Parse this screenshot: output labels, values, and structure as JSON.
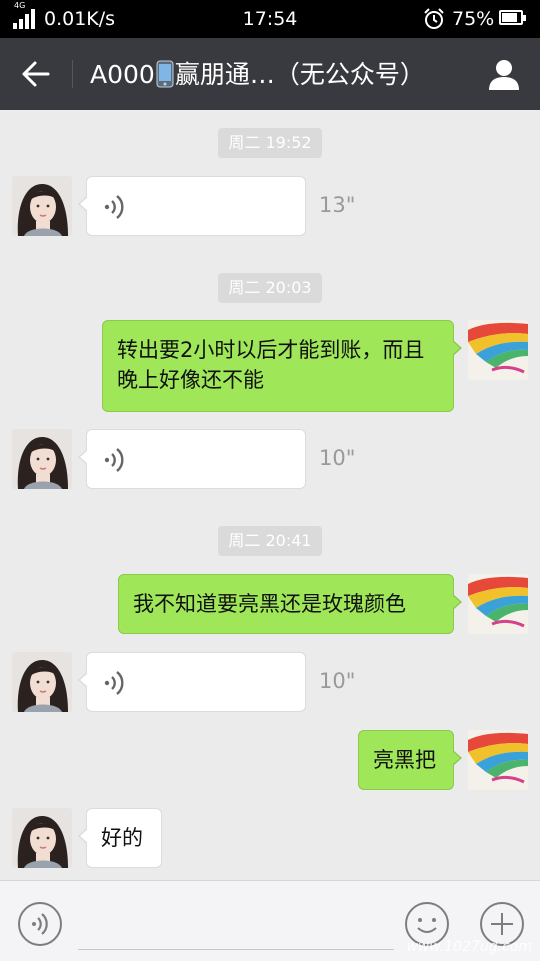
{
  "status_bar": {
    "network": "4G",
    "speed": "0.01K/s",
    "time": "17:54",
    "battery": "75%",
    "battery_level": 0.75,
    "signal_icon": "signal-icon",
    "alarm_icon": "alarm-icon"
  },
  "header": {
    "title_prefix": "A000",
    "title_emoji": "mobile-phone-emoji",
    "title_suffix": "赢朋通…（无公众号）",
    "back_icon": "back-arrow-icon",
    "profile_icon": "person-icon"
  },
  "messages": [
    {
      "kind": "time",
      "text": "周二 19:52"
    },
    {
      "kind": "voice",
      "side": "left",
      "duration": "13\""
    },
    {
      "kind": "time",
      "text": "周二 20:03"
    },
    {
      "kind": "text",
      "side": "right",
      "text": "转出要2小时以后才能到账，而且晚上好像还不能"
    },
    {
      "kind": "voice",
      "side": "left",
      "duration": "10\""
    },
    {
      "kind": "time",
      "text": "周二 20:41"
    },
    {
      "kind": "text",
      "side": "right",
      "text": "我不知道要亮黑还是玫瑰颜色"
    },
    {
      "kind": "voice",
      "side": "left",
      "duration": "10\""
    },
    {
      "kind": "text",
      "side": "right",
      "text": "亮黑把"
    },
    {
      "kind": "text",
      "side": "left",
      "text": "好的"
    }
  ],
  "input_bar": {
    "voice_icon": "voice-toggle-icon",
    "emoji_icon": "emoji-icon",
    "plus_icon": "plus-icon"
  },
  "watermark": "www.1027ug.com",
  "colors": {
    "header_bg": "#393a3f",
    "chat_bg": "#ebebeb",
    "sent_bubble": "#9fe658",
    "received_bubble": "#ffffff"
  }
}
